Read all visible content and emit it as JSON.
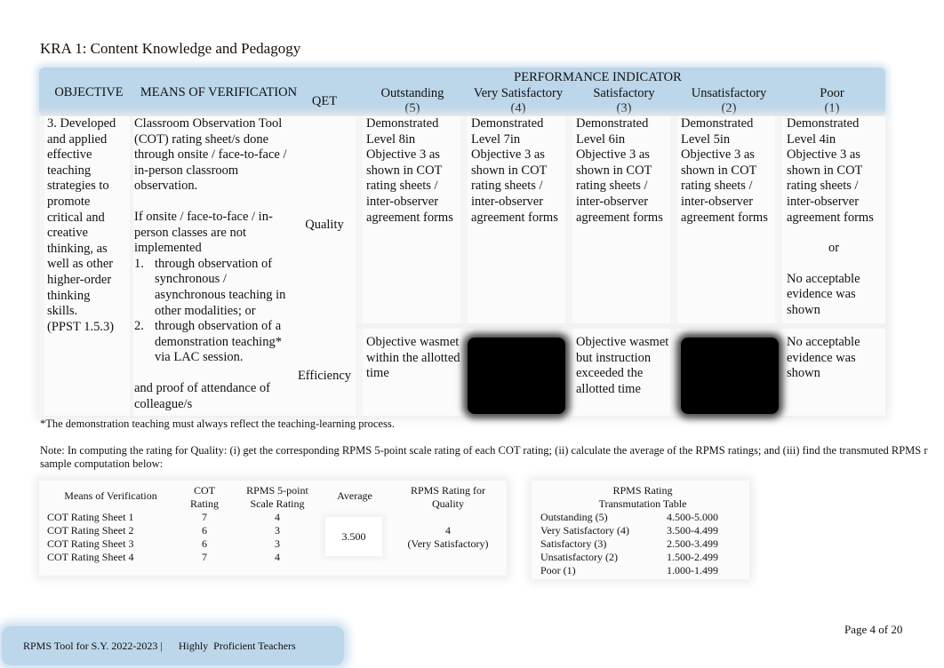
{
  "document": {
    "kra_title": "KRA 1: Content Knowledge and Pedagogy",
    "header": {
      "objective": "OBJECTIVE",
      "means_of_verification": "MEANS OF VERIFICATION",
      "qet": "QET",
      "performance_indicator": "PERFORMANCE INDICATOR",
      "ratings": [
        {
          "label": "Outstanding",
          "score": "(5)"
        },
        {
          "label": "Very Satisfactory",
          "score": "(4)"
        },
        {
          "label": "Satisfactory",
          "score": "(3)"
        },
        {
          "label": "Unsatisfactory",
          "score": "(2)"
        },
        {
          "label": "Poor",
          "score": "(1)"
        }
      ]
    },
    "row": {
      "objective_lines": [
        "3. Developed",
        "and applied",
        "effective",
        "teaching",
        "strategies to",
        "promote",
        "critical and",
        "creative",
        "thinking, as",
        "well as other",
        "higher-order",
        "thinking",
        "skills.",
        "(PPST 1.5.3)"
      ],
      "mov": {
        "para1": "Classroom Observation Tool (COT) rating sheet/s done through onsite / face-to-face / in-person classroom observation.",
        "para2": "If onsite / face-to-face / in-person classes are not implemented",
        "items": [
          {
            "num": "1.",
            "text": "through observation of synchronous / asynchronous teaching in other modalities; or"
          },
          {
            "num": "2.",
            "text": "through observation of a demonstration teaching* via LAC session."
          }
        ],
        "para3": "and proof of attendance of colleague/s"
      },
      "qet_quality": "Quality",
      "qet_efficiency": "Efficiency",
      "quality": [
        "Demonstrated Level 8in Objective 3 as shown in COT rating sheets / inter-observer agreement forms",
        "Demonstrated Level 7in Objective 3 as shown in COT rating sheets / inter-observer agreement forms",
        "Demonstrated Level 6in Objective 3 as shown in COT rating sheets / inter-observer agreement forms",
        "Demonstrated Level 5in Objective 3 as shown in COT rating sheets / inter-observer agreement forms",
        "Demonstrated Level 4in Objective 3 as shown in COT rating sheets / inter-observer agreement forms"
      ],
      "quality_poor_or": "or",
      "quality_poor_alt": "No acceptable evidence was shown",
      "efficiency": {
        "outstanding": "Objective wasmet within the allotted time",
        "very_satisfactory": "",
        "satisfactory": "Objective wasmet but instruction exceeded the allotted time",
        "unsatisfactory": "",
        "poor": "No acceptable evidence was shown"
      }
    },
    "footnote": "*The demonstration teaching must always reflect the teaching-learning process.",
    "note_line1": "Note: In computing the rating for Quality: (i) get the corresponding RPMS 5-point scale rating of each COT rating; (ii) calculate the average of the RPMS ratings; and (iii) find the transmuted RPMS r",
    "note_line2": "sample computation below:",
    "sample_table": {
      "headers": [
        "Means of Verification",
        "COT Rating",
        "RPMS 5-point Scale Rating",
        "Average",
        "RPMS Rating for Quality"
      ],
      "rows": [
        {
          "mov": "COT Rating Sheet 1",
          "cot": "7",
          "rpms": "4"
        },
        {
          "mov": "COT Rating Sheet 2",
          "cot": "6",
          "rpms": "3"
        },
        {
          "mov": "COT Rating Sheet 3",
          "cot": "6",
          "rpms": "3"
        },
        {
          "mov": "COT Rating Sheet 4",
          "cot": "7",
          "rpms": "4"
        }
      ],
      "average": "3.500",
      "rating_value": "4",
      "rating_label": "(Very Satisfactory)"
    },
    "transmutation_table": {
      "title_line1": "RPMS Rating",
      "title_line2": "Transmutation Table",
      "rows": [
        {
          "label": "Outstanding (5)",
          "range": "4.500-5.000"
        },
        {
          "label": "Very Satisfactory (4)",
          "range": "3.500-4.499"
        },
        {
          "label": "Satisfactory (3)",
          "range": "2.500-3.499"
        },
        {
          "label": "Unsatisfactory (2)",
          "range": "1.500-2.499"
        },
        {
          "label": "Poor (1)",
          "range": "1.000-1.499"
        }
      ]
    },
    "page_number": "Page 4 of 20",
    "footer_text": "RPMS Tool for S.Y. 2022-2023 |      Highly  Proficient Teachers"
  }
}
